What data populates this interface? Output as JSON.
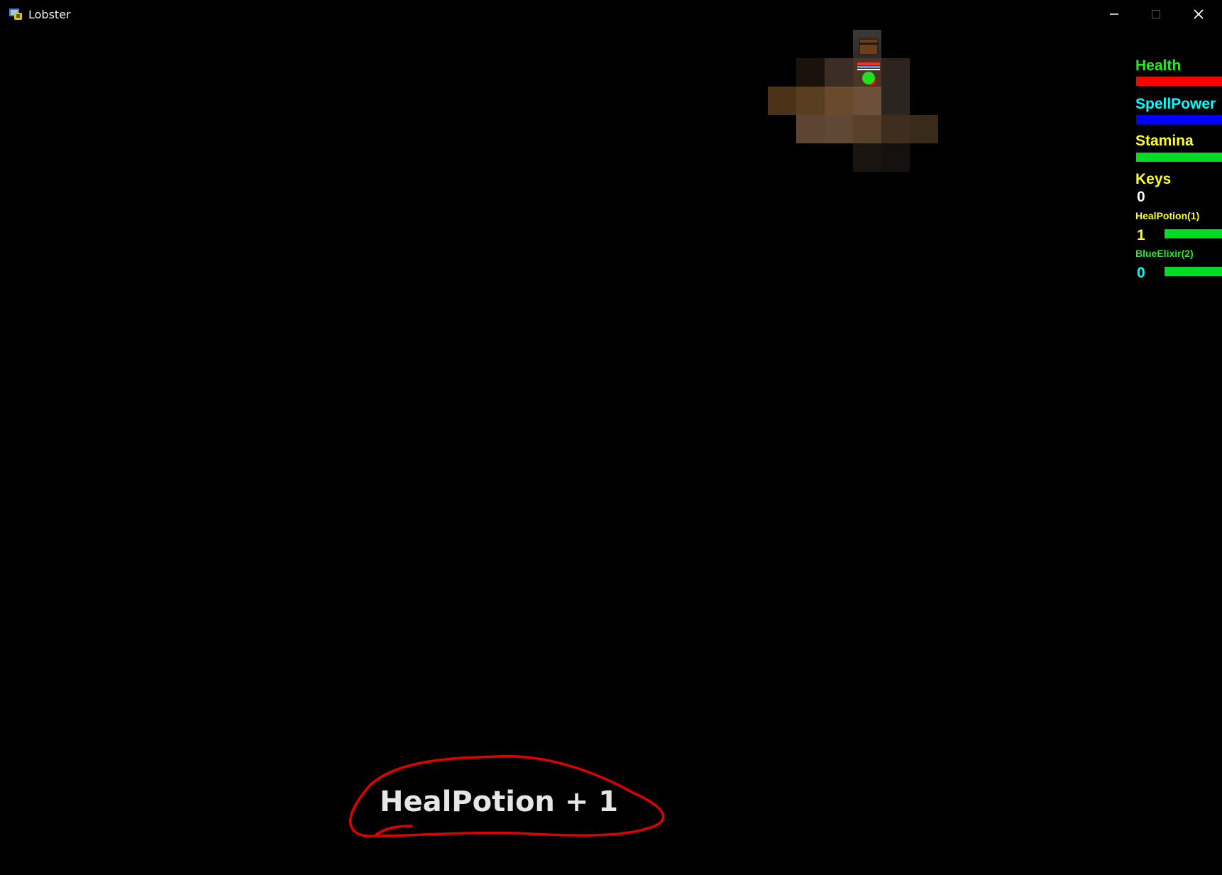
{
  "window": {
    "title": "Lobster",
    "icon": "lobster-app-icon",
    "controls": [
      "minimize-icon",
      "maximize-icon",
      "close-icon"
    ]
  },
  "hud": {
    "health_label": "Health",
    "spellpower_label": "SpellPower",
    "stamina_label": "Stamina",
    "keys_label": "Keys",
    "keys_count": "0",
    "item1_label": "HealPotion(1)",
    "item1_count": "1",
    "item2_label": "BlueElixir(2)",
    "item2_count": "0",
    "colors": {
      "health": "#ff0000",
      "spellpower": "#0000ff",
      "stamina": "#00dd22",
      "health_label": "#22ee22",
      "spellpower_label": "#00ffff",
      "stamina_label": "#ffff22",
      "keys_label": "#ffff22"
    }
  },
  "notification": {
    "text": "HealPotion + 1"
  },
  "annotation_color": "#e00000"
}
